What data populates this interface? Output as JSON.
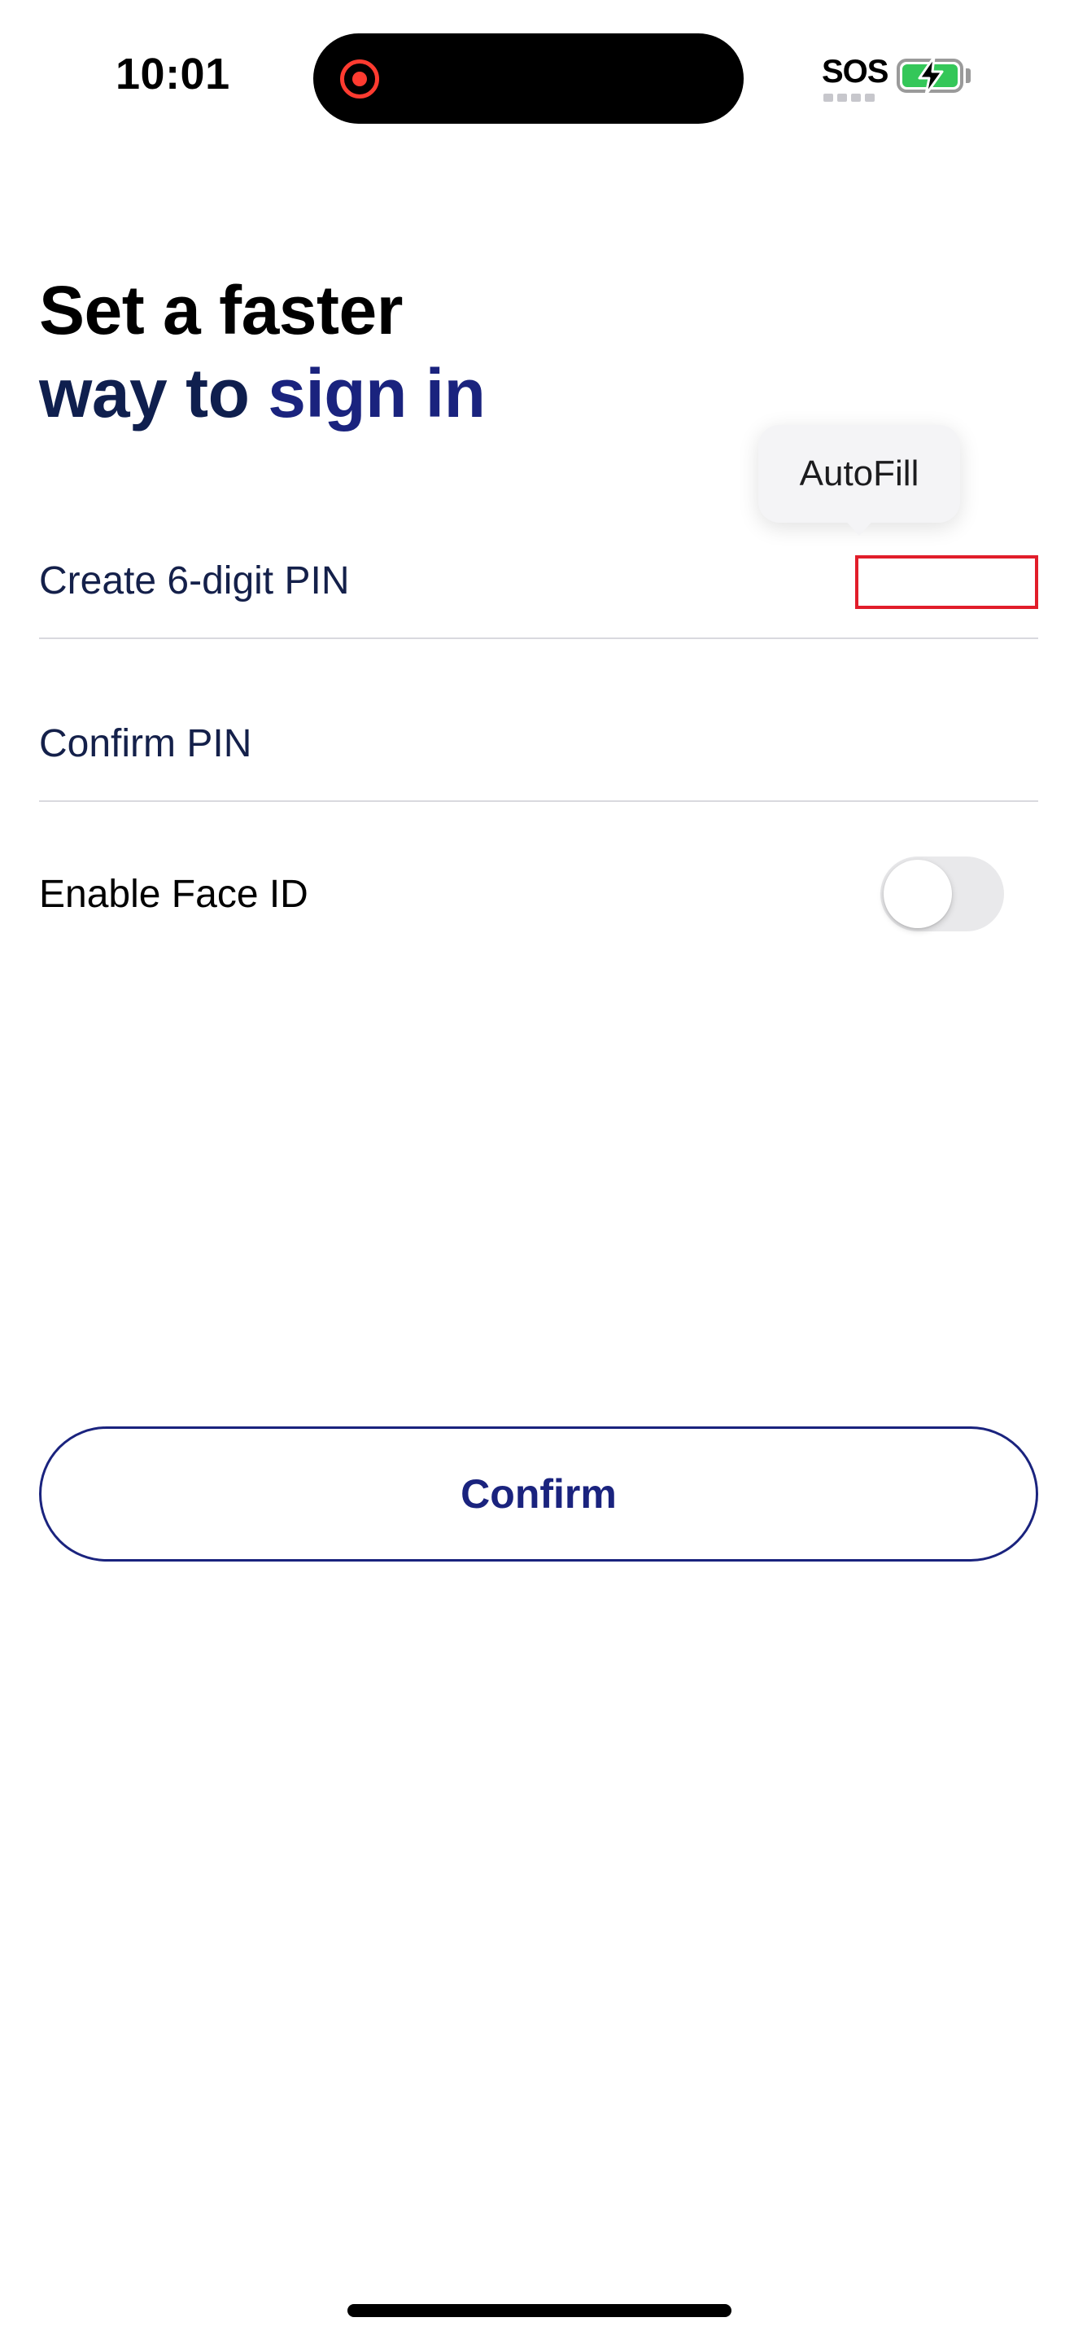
{
  "status_bar": {
    "time": "10:01",
    "carrier": "SOS",
    "battery_status": "charging",
    "recording": true
  },
  "heading": {
    "line1": "Set a faster",
    "line2_part1": "way to ",
    "line2_part2": "sign in"
  },
  "autofill": {
    "label": "AutoFill"
  },
  "form": {
    "pin_label": "Create 6-digit PIN",
    "pin_value": "",
    "confirm_label": "Confirm PIN",
    "confirm_value": "",
    "face_id_label": "Enable Face ID",
    "face_id_enabled": false
  },
  "actions": {
    "confirm_label": "Confirm"
  },
  "colors": {
    "brand_navy": "#1a237e",
    "text_navy": "#14204a",
    "focus_outline": "#e11d2a",
    "battery_green": "#34c759",
    "recording_red": "#ff3b30"
  },
  "icons": {
    "recording": "screen-recording-icon",
    "battery": "battery-charging-icon",
    "cellular": "signal-dots-icon"
  }
}
